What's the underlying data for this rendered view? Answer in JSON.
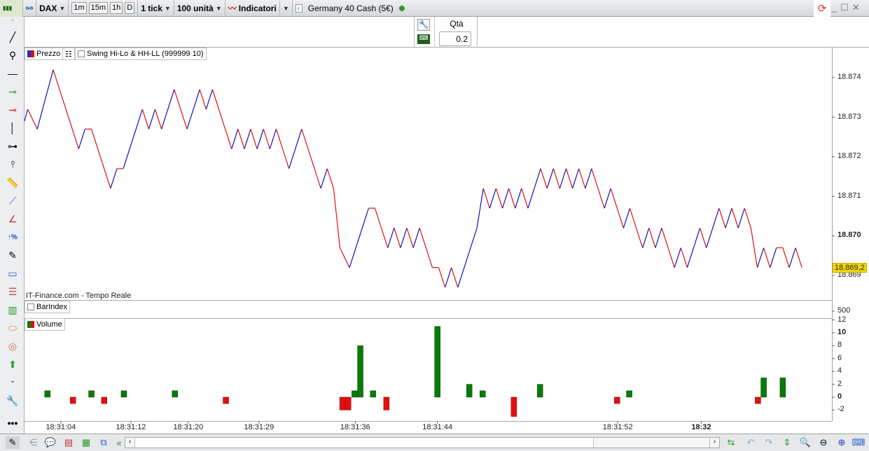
{
  "toolbar": {
    "instrument": "DAX",
    "timeframes": [
      "1m",
      "15m",
      "1h",
      "D"
    ],
    "tick": "1 tick",
    "units": "100 unità",
    "indicators": "Indicatori",
    "market": "Germany 40 Cash (5€)",
    "status_color": "#2e9e2e"
  },
  "order": {
    "qty_label": "Qtà",
    "qty_value": "0.2"
  },
  "legends": {
    "price": "Prezzo",
    "swing": "Swing Hi-Lo & HH-LL (999999 10)",
    "barindex": "BarIndex",
    "volume": "Volume"
  },
  "source": "IT-Finance.com - Tempo Reale",
  "colors": {
    "up": "#1010c0",
    "down": "#e01010",
    "vol_up": "#0a7a0a",
    "vol_down": "#e01010",
    "last_bg": "#f5d800"
  },
  "chart_data": {
    "type": "line",
    "price": {
      "ylim": [
        18.8686,
        18.8745
      ],
      "ticks": [
        "18.874",
        "18.873",
        "18.872",
        "18.871",
        "18.870",
        "18.869"
      ],
      "tick_values": [
        18.874,
        18.873,
        18.872,
        18.871,
        18.87,
        18.869
      ],
      "last_label": "18.869,2",
      "last": 18.8692,
      "x": [
        0,
        0.5,
        2,
        4.5,
        8.5,
        9.5,
        10.5,
        13.5,
        14.5,
        15.5,
        18.5,
        19.5,
        20.5,
        21.5,
        23.5,
        25.5,
        27.5,
        28.5,
        29.5,
        32.5,
        33.5,
        34.5,
        35.5,
        36.5,
        37.5,
        38.5,
        39.5,
        41.5,
        43.5,
        46.5,
        47.5,
        48.5,
        49.5,
        51,
        54,
        55,
        57,
        58,
        59,
        60,
        61,
        62,
        64,
        65,
        66,
        67,
        68,
        71,
        72,
        73,
        74,
        75,
        76,
        77,
        78,
        79,
        81,
        82,
        83,
        84,
        85,
        86,
        87,
        88,
        89,
        91,
        92,
        94,
        95,
        97,
        98,
        99,
        100,
        102,
        103,
        104,
        106,
        107,
        109,
        110,
        111,
        112,
        113,
        114,
        115,
        116,
        117,
        118,
        119,
        120,
        121,
        122
      ],
      "y": [
        18.8729,
        18.8732,
        18.8727,
        18.8742,
        18.8722,
        18.8727,
        18.8727,
        18.8712,
        18.8717,
        18.8717,
        18.8732,
        18.8727,
        18.8732,
        18.8727,
        18.8737,
        18.8727,
        18.8737,
        18.8732,
        18.8737,
        18.8722,
        18.8727,
        18.8722,
        18.8727,
        18.8722,
        18.8727,
        18.8722,
        18.8727,
        18.8717,
        18.8727,
        18.8712,
        18.8717,
        18.8712,
        18.8697,
        18.8692,
        18.8707,
        18.8707,
        18.8697,
        18.8702,
        18.8697,
        18.8702,
        18.8697,
        18.8702,
        18.8692,
        18.8692,
        18.8687,
        18.8692,
        18.8687,
        18.8702,
        18.8712,
        18.8707,
        18.8712,
        18.8707,
        18.8712,
        18.8707,
        18.8712,
        18.8707,
        18.8717,
        18.8712,
        18.8717,
        18.8712,
        18.8717,
        18.8712,
        18.8717,
        18.8712,
        18.8717,
        18.8707,
        18.8712,
        18.8702,
        18.8707,
        18.8697,
        18.8702,
        18.8697,
        18.8702,
        18.8692,
        18.8697,
        18.8692,
        18.8702,
        18.8697,
        18.8707,
        18.8702,
        18.8707,
        18.8702,
        18.8707,
        18.8702,
        18.8692,
        18.8697,
        18.8692,
        18.8697,
        18.8697,
        18.8692,
        18.8697,
        18.8692
      ]
    },
    "barindex": {
      "ticks": [
        "500"
      ]
    },
    "volume": {
      "ylim": [
        -3.9,
        12.2
      ],
      "ticks": [
        "12",
        "10",
        "8",
        "6",
        "4",
        "2",
        "0",
        "-2"
      ],
      "tick_values": [
        12,
        10,
        8,
        6,
        4,
        2,
        0,
        -2
      ],
      "x": [
        3.6,
        7.6,
        10.5,
        12.5,
        15.6,
        23.6,
        31.6,
        49.9,
        50.8,
        51.8,
        52.7,
        54.7,
        56.8,
        64.8,
        69.8,
        71.9,
        76.8,
        80.9,
        93,
        94.9,
        115.1,
        116,
        119
      ],
      "values": [
        1,
        -1,
        1,
        -1,
        1,
        1,
        -1,
        -2,
        -2,
        1,
        8,
        1,
        -2,
        11,
        2,
        1,
        -3,
        2,
        -1,
        1,
        -1,
        3,
        3
      ]
    },
    "time_ticks": [
      {
        "label": "18:31:04",
        "x": 5.7
      },
      {
        "label": "18:31:12",
        "x": 16.7
      },
      {
        "label": "18:31:20",
        "x": 25.7
      },
      {
        "label": "18:31:29",
        "x": 36.8
      },
      {
        "label": "18:31:36",
        "x": 51.9
      },
      {
        "label": "18:31:44",
        "x": 64.8
      },
      {
        "label": "18:31:52",
        "x": 93.1
      },
      {
        "label": "18:32",
        "x": 106.2,
        "bold": true
      }
    ]
  }
}
